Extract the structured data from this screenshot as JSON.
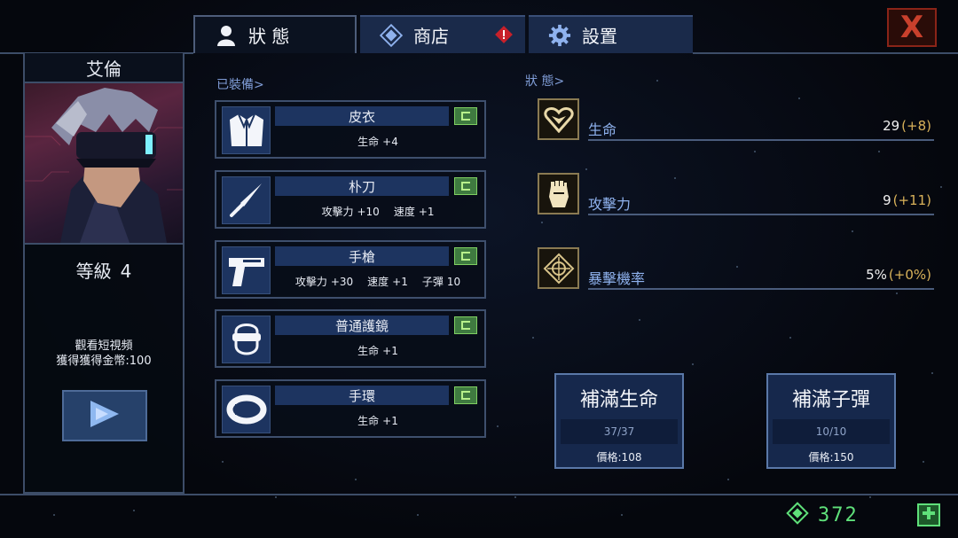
{
  "tabs": [
    {
      "label": "狀 態",
      "icon": "person-icon",
      "active": true
    },
    {
      "label": "商店",
      "icon": "diamond-icon",
      "active": false,
      "alert_icon": "alert-diamond-icon"
    },
    {
      "label": "設置",
      "icon": "gear-icon",
      "active": false
    }
  ],
  "close": {
    "label": "X"
  },
  "character": {
    "name": "艾倫",
    "level_label": "等級",
    "level_value": "4",
    "video_line1": "觀看短視頻",
    "video_line2": "獲得獲得金幣:100"
  },
  "equipped": {
    "title": "已裝備>",
    "items": [
      {
        "name": "皮衣",
        "icon": "jacket-icon",
        "stats": [
          {
            "label": "生命",
            "value": "+4"
          }
        ]
      },
      {
        "name": "朴刀",
        "icon": "blade-icon",
        "stats": [
          {
            "label": "攻擊力",
            "value": "+10"
          },
          {
            "label": "速度",
            "value": "+1"
          }
        ]
      },
      {
        "name": "手槍",
        "icon": "pistol-icon",
        "stats": [
          {
            "label": "攻擊力",
            "value": "+30"
          },
          {
            "label": "速度",
            "value": "+1"
          },
          {
            "label": "子彈",
            "value": "10"
          }
        ]
      },
      {
        "name": "普通護鏡",
        "icon": "goggles-icon",
        "stats": [
          {
            "label": "生命",
            "value": "+1"
          }
        ]
      },
      {
        "name": "手環",
        "icon": "bracelet-icon",
        "stats": [
          {
            "label": "生命",
            "value": "+1"
          }
        ]
      }
    ]
  },
  "status": {
    "title": "狀 態>",
    "rows": [
      {
        "name": "生命",
        "icon": "heart-icon",
        "value": "29",
        "bonus": "(+8)"
      },
      {
        "name": "攻擊力",
        "icon": "fist-icon",
        "value": "9",
        "bonus": "(+11)"
      },
      {
        "name": "暴擊機率",
        "icon": "crosshair-icon",
        "value": "5%",
        "bonus": "(+0%)"
      }
    ]
  },
  "buttons": [
    {
      "title": "補滿生命",
      "count": "37/37",
      "price": "價格:108"
    },
    {
      "title": "補滿子彈",
      "count": "10/10",
      "price": "價格:150"
    }
  ],
  "currency": {
    "value": "372",
    "icon": "gem-icon",
    "add_icon": "plus-icon"
  },
  "colors": {
    "accent_blue": "#1d3460",
    "grade_green": "#3f7a40",
    "bonus_gold": "#d9b25a",
    "currency_green": "#5fe07a",
    "close_red": "#c8402c"
  }
}
